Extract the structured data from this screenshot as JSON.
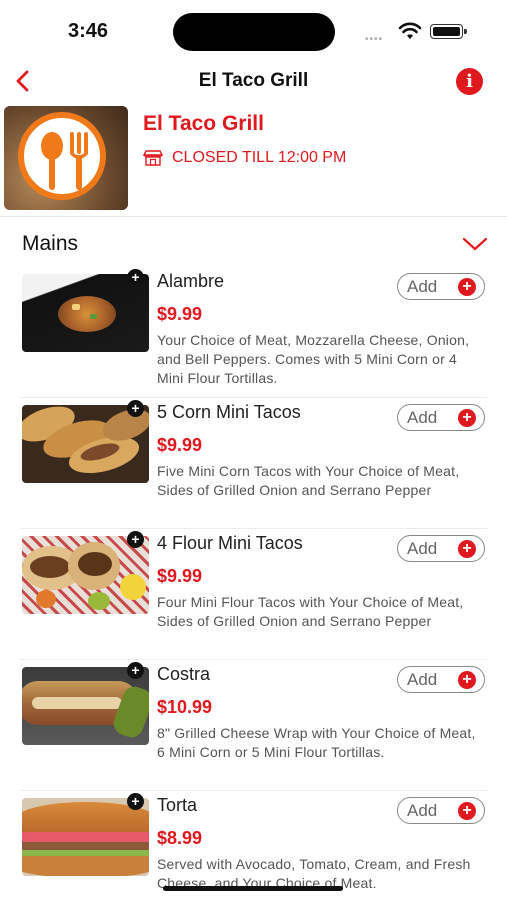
{
  "status": {
    "time": "3:46"
  },
  "nav": {
    "title": "El Taco Grill"
  },
  "restaurant": {
    "name": "El Taco Grill",
    "status": "CLOSED TILL 12:00 PM"
  },
  "section": {
    "title": "Mains"
  },
  "add_label": "Add",
  "items": [
    {
      "name": "Alambre",
      "price": "$9.99",
      "description": "Your Choice of Meat, Mozzarella Cheese, Onion, and Bell Peppers. Comes with 5 Mini Corn or 4 Mini Flour Tortillas."
    },
    {
      "name": "5 Corn Mini Tacos",
      "price": "$9.99",
      "description": "Five Mini Corn Tacos with Your Choice of Meat, Sides of Grilled Onion and Serrano Pepper"
    },
    {
      "name": "4 Flour Mini Tacos",
      "price": "$9.99",
      "description": "Four Mini Flour Tacos with Your Choice of Meat, Sides of Grilled Onion and Serrano Pepper"
    },
    {
      "name": "Costra",
      "price": "$10.99",
      "description": "8\" Grilled Cheese Wrap with Your Choice of Meat, 6 Mini Corn or 5 Mini Flour Tortillas."
    },
    {
      "name": "Torta",
      "price": "$8.99",
      "description": "Served with Avocado, Tomato, Cream, and Fresh Cheese, and Your Choice of Meat."
    }
  ],
  "colors": {
    "accent": "#e0191e",
    "logo_orange": "#f07a1a"
  },
  "icons": {
    "back": "chevron-left-icon",
    "info": "info-icon",
    "store": "store-icon",
    "collapse": "chevron-down-icon",
    "add": "plus-circle-icon"
  }
}
